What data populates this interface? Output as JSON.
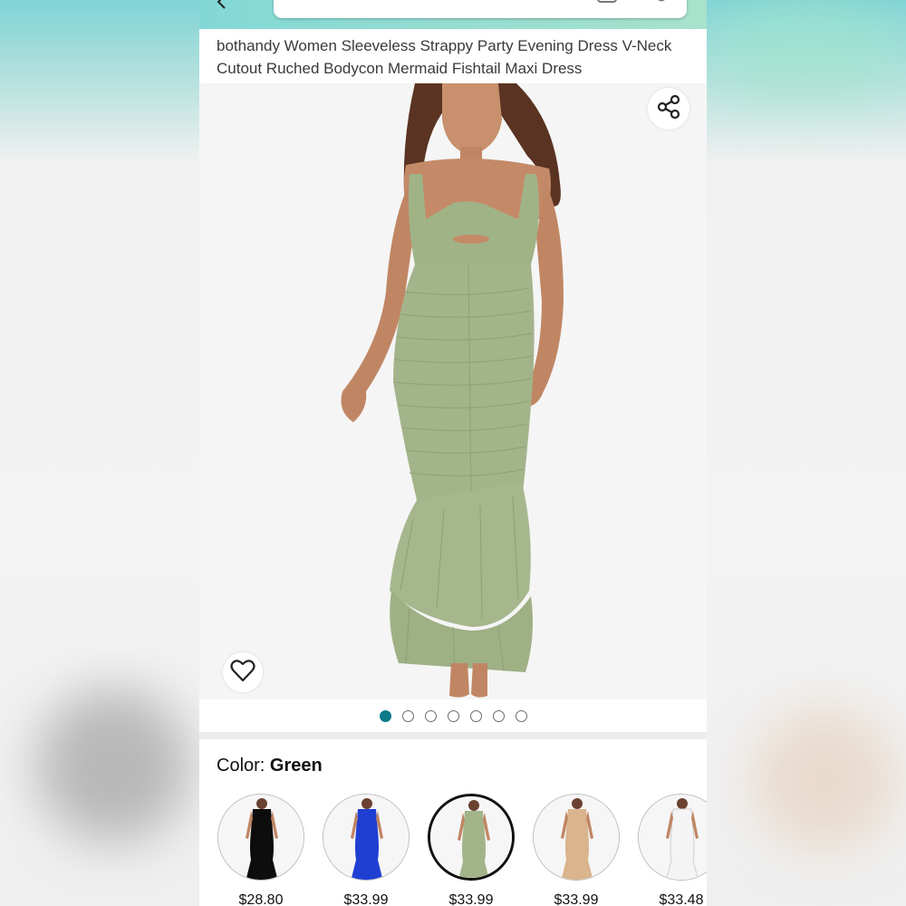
{
  "product": {
    "title": "bothandy Women Sleeveless Strappy Party Evening Dress V-Neck Cutout Ruched Bodycon Mermaid Fishtail Maxi Dress"
  },
  "gallery": {
    "image_count": 7,
    "active_index": 0
  },
  "color": {
    "label": "Color:",
    "selected": "Green"
  },
  "variants": [
    {
      "color_name": "black",
      "hex": "#0d0d0d",
      "price": "$28.80"
    },
    {
      "color_name": "blue",
      "hex": "#1f3fd3",
      "price": "$33.99"
    },
    {
      "color_name": "green",
      "hex": "#a3b48a",
      "price": "$33.99"
    },
    {
      "color_name": "tan",
      "hex": "#d9b48d",
      "price": "$33.99"
    },
    {
      "color_name": "white",
      "hex": "#f4f4f4",
      "price": "$33.48"
    }
  ],
  "theme": {
    "accent": "#0b7a8a",
    "header_gradient": [
      "#82d8d6",
      "#a8e2cc"
    ]
  },
  "icons": {
    "share": "share-icon",
    "favorite": "heart-icon"
  }
}
